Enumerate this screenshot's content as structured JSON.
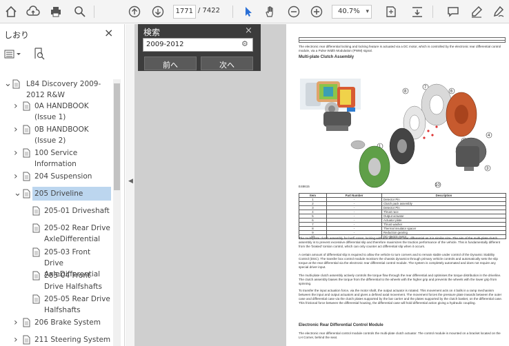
{
  "toolbar": {
    "page_current": "1771",
    "page_total": "/ 7422",
    "zoom": "40.7%",
    "icons": [
      "home-icon",
      "cloud-upload-icon",
      "print-icon",
      "zoom-search-icon",
      "page-up-icon",
      "page-down-icon",
      "select-cursor-icon",
      "hand-tool-icon",
      "zoom-out-icon",
      "zoom-in-icon",
      "fit-page-icon",
      "scroll-mode-icon",
      "comment-icon",
      "highlight-pen-icon",
      "sign-icon"
    ]
  },
  "sidebar": {
    "title": "しおり",
    "close": "×",
    "items": [
      {
        "label": "L84 Discovery 2009-2012 R&W"
      },
      {
        "label": "0A HANDBOOK (Issue 1)"
      },
      {
        "label": "0B HANDBOOK (Issue 2)"
      },
      {
        "label": "100 Service Information"
      },
      {
        "label": "204 Suspension"
      },
      {
        "label": "205 Driveline"
      },
      {
        "label": "205-01 Driveshaft"
      },
      {
        "label": "205-02 Rear Drive AxleDifferential"
      },
      {
        "label": "205-03 Front Drive AxleDifferential"
      },
      {
        "label": "205-04 Front Drive Halfshafts"
      },
      {
        "label": "205-05 Rear Drive Halfshafts"
      },
      {
        "label": "206 Brake System"
      },
      {
        "label": "211 Steering System"
      }
    ]
  },
  "find": {
    "title": "検索",
    "close": "×",
    "query": "2009-2012",
    "prev": "前へ",
    "next": "次へ"
  },
  "doc": {
    "intro": "The electronic rear differential locking and locking feature is actuated via a DC motor, which is controlled by the electronic rear differential control module, via a Pulse Width Modulation (PWM) signal.",
    "section1": "Multi-plate Clutch Assembly",
    "fig_caption": "E48615",
    "table_headers": [
      "Item",
      "Part Number",
      "Description"
    ],
    "table_rows": [
      [
        "1",
        "-",
        "Detector Pin"
      ],
      [
        "2",
        "-",
        "Clutch pack assembly"
      ],
      [
        "3",
        "-",
        "Detector Pin"
      ],
      [
        "4",
        "-",
        "Thrust race"
      ],
      [
        "5",
        "-",
        "Output actuator"
      ],
      [
        "6",
        "-",
        "Actuator plate"
      ],
      [
        "7",
        "-",
        "Thrust washer"
      ],
      [
        "8",
        "-",
        "Thermal insulator spacer"
      ],
      [
        "9",
        "-",
        "Reduction gearing"
      ],
      [
        "10",
        "-",
        "DC electric motor"
      ]
    ],
    "para1": "The multi-plate clutch assembly for both rotors; locking with and electronic rear differential as it is similar size. The aim of the multi-plate clutch assembly is to prevent excessive differential slip and therefore maximizes the traction performance of the vehicle. This is fundamentally different from the 'braked' torsion control, which can only counter act differential slip when it occurs.",
    "para2": "A certain amount of differential slip is required to allow the vehicle to turn corners and to remain stable under control of the Dynamic Stability Control (DSC). The transfer box control module monitors the chassis dynamics through primary vehicle controls and automatically sets the slip torque at the rear differential via the electronic rear differential control module. The system is completely automated and does not require any special driver input.",
    "para3": "The multi-plate clutch assembly actively controls the torque flow through the rear differential and optimises the torque distribution in the driveline. The clutch assembly biases the torque from the differential to the wheels with the higher grip and prevents the wheels with the lower grip from spinning.",
    "para4": "To transfer the input actuation force, via the motor shaft, the output actuator is rotated. This movement acts on 4 balls in a ramp mechanism between the input and output actuators and gives a defined axial movement. The movement forces the pressure plate inwards between the outer case and differential case via the clutch plates supported by the bar carrier and the plates supported by the clutch basket, on the differential case. This frictional force between the differential housing, the differential case will hold differential action giving a hydraulic coupling.",
    "section2": "Electronic Rear Differential Control Module",
    "para5": "The electronic rear differential control module controls the multi-plate clutch actuator. The control module is mounted on a bracket located on the LH Corner, behind the seat."
  }
}
